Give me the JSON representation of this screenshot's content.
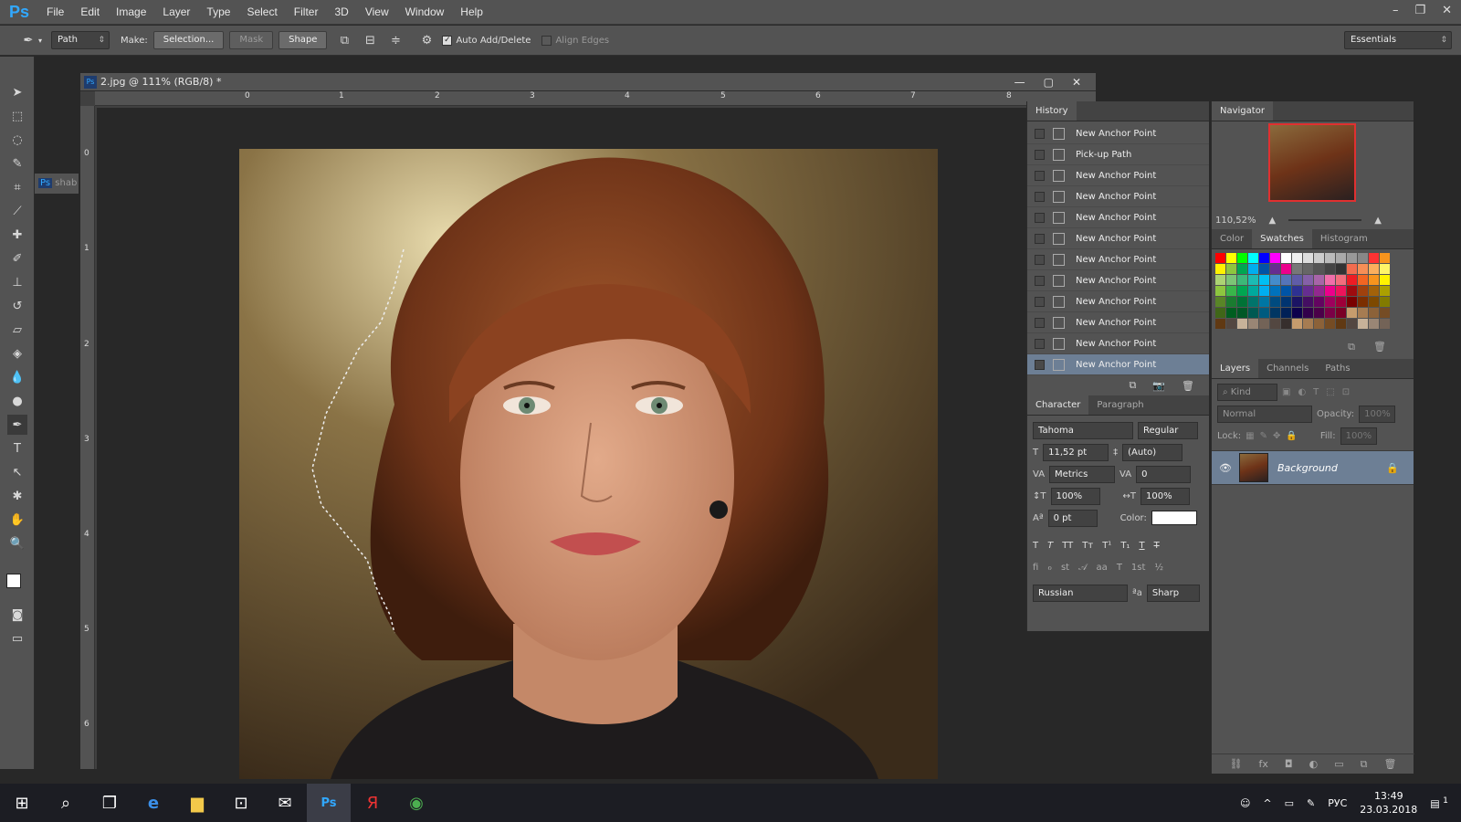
{
  "app": {
    "logo": "Ps"
  },
  "menu": [
    "File",
    "Edit",
    "Image",
    "Layer",
    "Type",
    "Select",
    "Filter",
    "3D",
    "View",
    "Window",
    "Help"
  ],
  "window_controls": {
    "minimize": "–",
    "restore": "❐",
    "close": "✕"
  },
  "options": {
    "mode": "Path",
    "make_label": "Make:",
    "selection_btn": "Selection...",
    "mask_btn": "Mask",
    "shape_btn": "Shape",
    "auto_add_delete": "Auto Add/Delete",
    "align_edges": "Align Edges",
    "workspace": "Essentials"
  },
  "document": {
    "title": "2.jpg @ 111% (RGB/8) *",
    "side_tab": "shab",
    "ruler_h": [
      "0",
      "1",
      "2",
      "3",
      "4",
      "5",
      "6",
      "7",
      "8"
    ],
    "ruler_v": [
      "0",
      "1",
      "2",
      "3",
      "4",
      "5",
      "6"
    ]
  },
  "history": {
    "title": "History",
    "items": [
      "New Anchor Point",
      "Pick-up Path",
      "New Anchor Point",
      "New Anchor Point",
      "New Anchor Point",
      "New Anchor Point",
      "New Anchor Point",
      "New Anchor Point",
      "New Anchor Point",
      "New Anchor Point",
      "New Anchor Point",
      "New Anchor Point"
    ],
    "active_index": 11
  },
  "character": {
    "tabs": [
      "Character",
      "Paragraph"
    ],
    "font": "Tahoma",
    "style": "Regular",
    "size": "11,52 pt",
    "leading": "(Auto)",
    "kerning": "Metrics",
    "tracking": "0",
    "vscale": "100%",
    "hscale": "100%",
    "baseline": "0 pt",
    "color_label": "Color:",
    "language": "Russian",
    "aa_label": "ªa",
    "antialias": "Sharp"
  },
  "navigator": {
    "title": "Navigator",
    "zoom": "110,52%"
  },
  "color_tabs": [
    "Color",
    "Swatches",
    "Histogram"
  ],
  "swatch_colors": [
    "#ff0000",
    "#ffff00",
    "#00ff00",
    "#00ffff",
    "#0000ff",
    "#ff00ff",
    "#ffffff",
    "#eeeeee",
    "#dddddd",
    "#cccccc",
    "#bbbbbb",
    "#aaaaaa",
    "#999999",
    "#888888",
    "#ff3333",
    "#f7941d",
    "#fff200",
    "#8dc63f",
    "#00a651",
    "#00aeef",
    "#0054a6",
    "#662d91",
    "#ec008c",
    "#777777",
    "#666666",
    "#555555",
    "#444444",
    "#333333",
    "#f26c4f",
    "#f68e56",
    "#fbaf5d",
    "#fff568",
    "#acd373",
    "#7cc576",
    "#3cb878",
    "#1cbbb4",
    "#00bff3",
    "#448ccb",
    "#5574b9",
    "#605ca8",
    "#8560a8",
    "#a864a8",
    "#f06eaa",
    "#f26d7d",
    "#ed1c24",
    "#f26522",
    "#f7941d",
    "#fff200",
    "#8dc63f",
    "#39b54a",
    "#00a651",
    "#00a99d",
    "#00aeef",
    "#0072bc",
    "#0054a6",
    "#2e3192",
    "#662d91",
    "#92278f",
    "#ec008c",
    "#ed145b",
    "#9e0b0f",
    "#a0410d",
    "#a36209",
    "#aba000",
    "#598527",
    "#1a7b30",
    "#007236",
    "#00746b",
    "#0076a3",
    "#004b80",
    "#003471",
    "#1b1464",
    "#440e62",
    "#630460",
    "#9e005d",
    "#9e0039",
    "#790000",
    "#7b2e00",
    "#7d4900",
    "#827b00",
    "#406618",
    "#005e20",
    "#005826",
    "#005952",
    "#005b7f",
    "#003663",
    "#002157",
    "#0d004c",
    "#32004b",
    "#4b0049",
    "#7b0046",
    "#7a0026",
    "#c69c6d",
    "#a67c52",
    "#8c6239",
    "#754c24",
    "#603913",
    "#534741",
    "#c7b299",
    "#998675",
    "#736357",
    "#534741",
    "#362f2d",
    "#c69c6d",
    "#a67c52",
    "#8c6239",
    "#754c24",
    "#603913",
    "#534741",
    "#c7b299",
    "#998675",
    "#736357"
  ],
  "layers": {
    "tabs": [
      "Layers",
      "Channels",
      "Paths"
    ],
    "kind": "Kind",
    "blend": "Normal",
    "opacity_label": "Opacity:",
    "opacity": "100%",
    "lock_label": "Lock:",
    "fill_label": "Fill:",
    "fill": "100%",
    "items": [
      {
        "name": "Background",
        "visible": true,
        "locked": true
      }
    ]
  },
  "taskbar": {
    "lang": "РУС",
    "time": "13:49",
    "date": "23.03.2018",
    "notif": "1"
  }
}
